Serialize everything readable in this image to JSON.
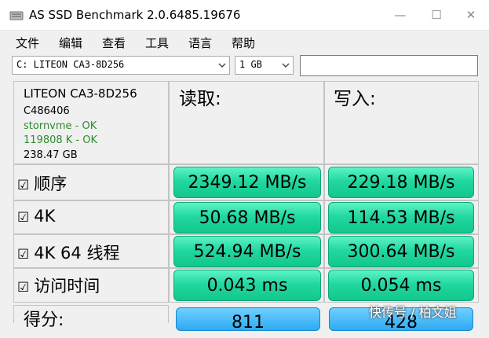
{
  "window": {
    "title": "AS SSD Benchmark 2.0.6485.19676",
    "controls": {
      "minimize": "—",
      "maximize": "☐",
      "close": "✕"
    }
  },
  "menu": [
    "文件",
    "编辑",
    "查看",
    "工具",
    "语言",
    "帮助"
  ],
  "toolbar": {
    "drive_select": "C: LITEON CA3-8D256",
    "size_select": "1 GB",
    "name_input": ""
  },
  "drive_info": {
    "model": "LITEON CA3-8D256",
    "firmware": "C486406",
    "driver_status": "stornvme - OK",
    "alignment_status": "119808 K - OK",
    "capacity": "238.47 GB"
  },
  "headers": {
    "read": "读取:",
    "write": "写入:"
  },
  "rows": [
    {
      "checkbox": "☑",
      "label": "顺序",
      "read": "2349.12 MB/s",
      "write": "229.18 MB/s"
    },
    {
      "checkbox": "☑",
      "label": "4K",
      "read": "50.68 MB/s",
      "write": "114.53 MB/s"
    },
    {
      "checkbox": "☑",
      "label": "4K 64 线程",
      "read": "524.94 MB/s",
      "write": "300.64 MB/s"
    },
    {
      "checkbox": "☑",
      "label": "访问时间",
      "read": "0.043 ms",
      "write": "0.054 ms"
    }
  ],
  "score": {
    "label": "得分:",
    "read": "811",
    "write": "428"
  },
  "watermark": "快传号 / 柏文姐",
  "colors": {
    "result_cell": "#22d8a0",
    "score_cell": "#2eaaf2",
    "status_ok": "#2f8a2f"
  }
}
